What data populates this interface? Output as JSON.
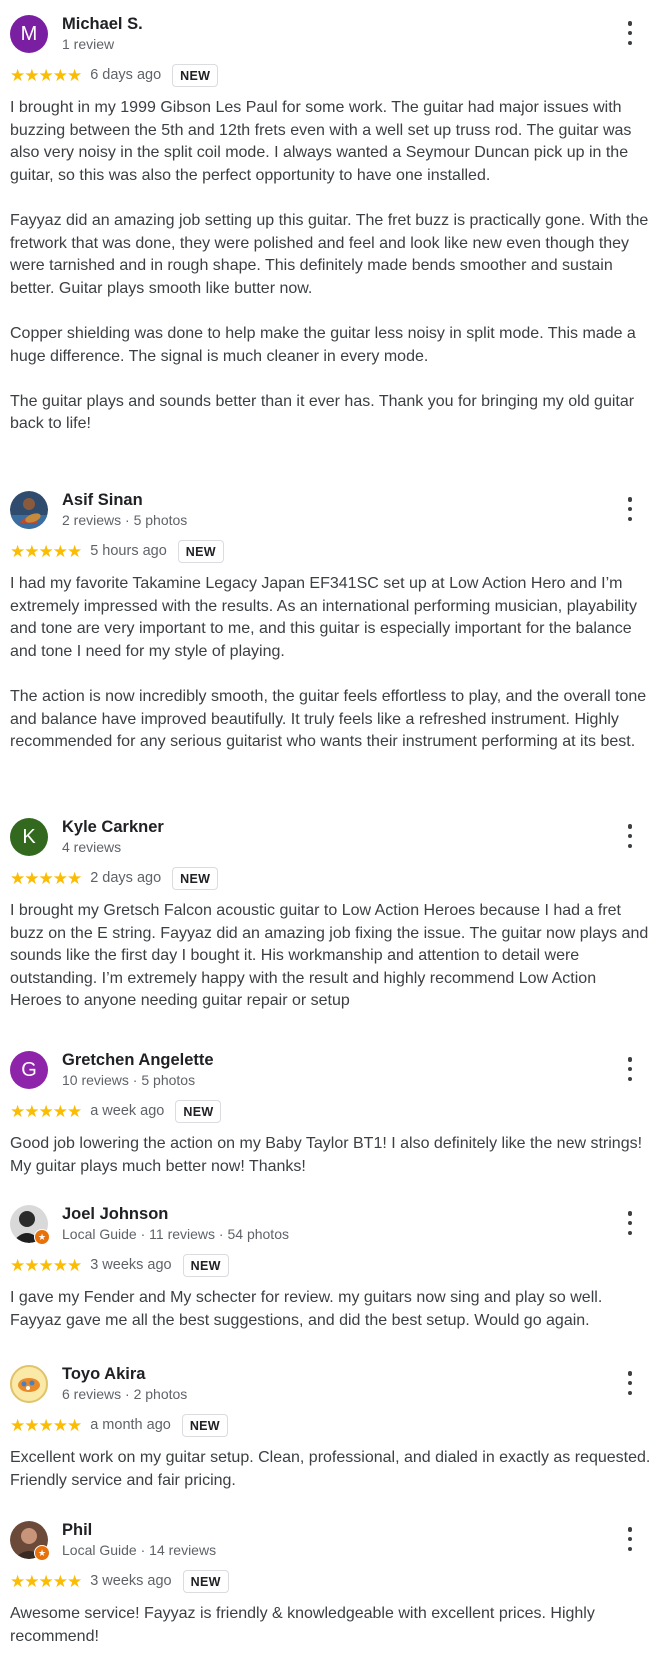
{
  "reviews": [
    {
      "name": "Michael S.",
      "meta": "1 review",
      "avatar_letter": "M",
      "avatar_color": "#7b1fa2",
      "stars": "★★★★★",
      "when": "6 days ago",
      "badge": "NEW",
      "text": "I brought in my 1999 Gibson Les Paul for some work. The guitar had major issues with buzzing between the 5th and 12th frets even with a well set up truss rod. The guitar was also very noisy in the split coil mode. I always wanted a Seymour Duncan pick up in the guitar, so this was also the perfect opportunity to have one installed.\n\nFayyaz did an amazing job setting up this guitar. The fret buzz is practically gone. With the fretwork that was done, they were polished and feel and look like new even though they were tarnished and in rough shape. This definitely made bends smoother and sustain better. Guitar plays smooth like butter now.\n\nCopper shielding was done to help make the guitar less noisy in split mode. This made a huge difference. The signal is much cleaner in every mode.\n\nThe guitar plays and sounds better than it ever has. Thank you for bringing my old guitar back to life!"
    },
    {
      "name": "Asif Sinan",
      "meta": "2 reviews · 5 photos",
      "avatar_icon": "person-with-guitar-photo",
      "stars": "★★★★★",
      "when": "5 hours ago",
      "badge": "NEW",
      "text": "I had my favorite Takamine Legacy Japan EF341SC set up at Low Action Hero and I’m extremely impressed with the results. As an international performing musician, playability and tone are very important to me, and this guitar is especially important for the balance and tone I need for my style of playing.\n\nThe action is now incredibly smooth, the guitar feels effortless to play, and the overall tone and balance have improved beautifully. It truly feels like a refreshed instrument. Highly recommended for any serious guitarist who wants their instrument performing at its best."
    },
    {
      "name": "Kyle Carkner",
      "meta": "4 reviews",
      "avatar_letter": "K",
      "avatar_color": "#33691e",
      "stars": "★★★★★",
      "when": "2 days ago",
      "badge": "NEW",
      "text": "I brought my Gretsch Falcon acoustic guitar to Low Action Heroes because I had a fret buzz on the E string. Fayyaz did an amazing job fixing the issue. The guitar now plays and sounds like the first day I bought it. His workmanship and attention to detail were outstanding. I’m extremely happy with the result and highly recommend Low Action Heroes to anyone needing guitar repair or setup"
    },
    {
      "name": "Gretchen Angelette",
      "meta": "10 reviews · 5 photos",
      "avatar_letter": "G",
      "avatar_color": "#8e24aa",
      "stars": "★★★★★",
      "when": "a week ago",
      "badge": "NEW",
      "text": "Good job lowering the action on my Baby Taylor BT1! I also definitely like the new strings! My guitar plays much better now! Thanks!"
    },
    {
      "name": "Joel Johnson",
      "meta": "Local Guide · 11 reviews · 54 photos",
      "avatar_icon": "profile-photo",
      "stars": "★★★★★",
      "when": "3 weeks ago",
      "badge": "NEW",
      "text": "I gave my Fender and My schecter for review. my guitars now sing and play so well. Fayyaz gave me all the best suggestions, and did the best setup. Would go again."
    },
    {
      "name": "Toyo Akira",
      "meta": "6 reviews · 2 photos",
      "avatar_icon": "food-photo",
      "stars": "★★★★★",
      "when": "a month ago",
      "badge": "NEW",
      "text": "Excellent work on my guitar setup. Clean, professional, and dialed in exactly as requested. Friendly service and fair pricing."
    },
    {
      "name": "Phil",
      "meta": "Local Guide · 14 reviews",
      "avatar_icon": "profile-photo",
      "stars": "★★★★★",
      "when": "3 weeks ago",
      "badge": "NEW",
      "text": "Awesome service! Fayyaz is friendly & knowledgeable with excellent prices. Highly recommend!"
    }
  ]
}
